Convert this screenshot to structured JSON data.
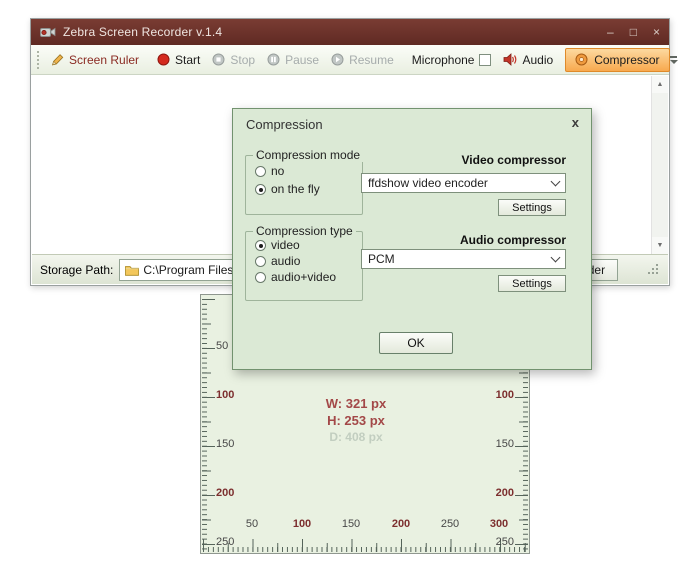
{
  "window": {
    "title": "Zebra Screen Recorder v.1.4",
    "controls": {
      "minimize": "–",
      "maximize": "□",
      "close": "×"
    }
  },
  "toolbar": {
    "screen_ruler_label": "Screen Ruler",
    "start_label": "Start",
    "stop_label": "Stop",
    "pause_label": "Pause",
    "resume_label": "Resume",
    "microphone_label": "Microphone",
    "audio_label": "Audio",
    "compressor_label": "Compressor"
  },
  "statusbar": {
    "storage_label": "Storage Path:",
    "storage_path_value": "C:\\Program Files",
    "open_folder_label": "Open Folder"
  },
  "dialog": {
    "title": "Compression",
    "close_glyph": "x",
    "mode_group": {
      "label": "Compression mode",
      "options": [
        {
          "label": "no",
          "selected": false
        },
        {
          "label": "on the fly",
          "selected": true
        }
      ]
    },
    "type_group": {
      "label": "Compression type",
      "options": [
        {
          "label": "video",
          "selected": true
        },
        {
          "label": "audio",
          "selected": false
        },
        {
          "label": "audio+video",
          "selected": false
        }
      ]
    },
    "video_section": {
      "label": "Video compressor",
      "value": "ffdshow video encoder",
      "settings_label": "Settings"
    },
    "audio_section": {
      "label": "Audio compressor",
      "value": "PCM",
      "settings_label": "Settings"
    },
    "ok_label": "OK"
  },
  "ruler": {
    "side_labels": [
      {
        "text": "50",
        "major": false
      },
      {
        "text": "100",
        "major": true
      },
      {
        "text": "150",
        "major": false
      },
      {
        "text": "200",
        "major": true
      },
      {
        "text": "250",
        "major": false
      }
    ],
    "bottom_labels": [
      {
        "text": "50",
        "major": false
      },
      {
        "text": "100",
        "major": true
      },
      {
        "text": "150",
        "major": false
      },
      {
        "text": "200",
        "major": true
      },
      {
        "text": "250",
        "major": false
      },
      {
        "text": "300",
        "major": true
      }
    ],
    "width_readout": "W: 321 px",
    "height_readout": "H: 253 px",
    "faded_readout": "D: 408 px"
  },
  "icons": {
    "scroll_up": "▲",
    "scroll_down": "▼"
  },
  "colors": {
    "titlebar": "#6e3129",
    "compressor_highlight": "#f8a94e",
    "dialog_bg": "#dbe9d5",
    "ruler_bg": "#e9f1e1",
    "accent_record_red": "#d42a1e",
    "readout_maroon": "#a34848"
  }
}
